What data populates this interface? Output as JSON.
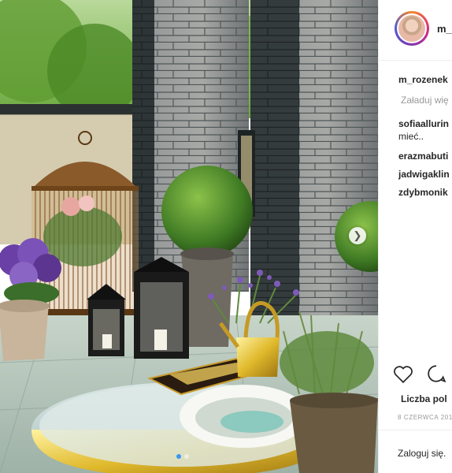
{
  "post": {
    "header": {
      "username": "m_rozenek"
    },
    "load_more": "Załaduj wię",
    "comments": [
      {
        "user": "m_rozenek",
        "text": ""
      },
      {
        "user": "sofiaallurin",
        "text": ""
      },
      {
        "user": "",
        "text": "mieć.."
      },
      {
        "user": "erazmabuti",
        "text": ""
      },
      {
        "user": "jadwigaklin",
        "text": ""
      },
      {
        "user": "zdybmonik",
        "text": ""
      }
    ],
    "likes_label": "Liczba pol",
    "date": "8 CZERWCA 201",
    "login": "Zaloguj się."
  },
  "photo": {
    "icons": {
      "next": "chevron-right-icon",
      "like": "heart-icon",
      "comment": "comment-icon"
    },
    "carousel_dots": 2,
    "active_dot": 0
  },
  "colors": {
    "accent": "#3897f0",
    "text": "#262626",
    "muted": "#999999"
  }
}
